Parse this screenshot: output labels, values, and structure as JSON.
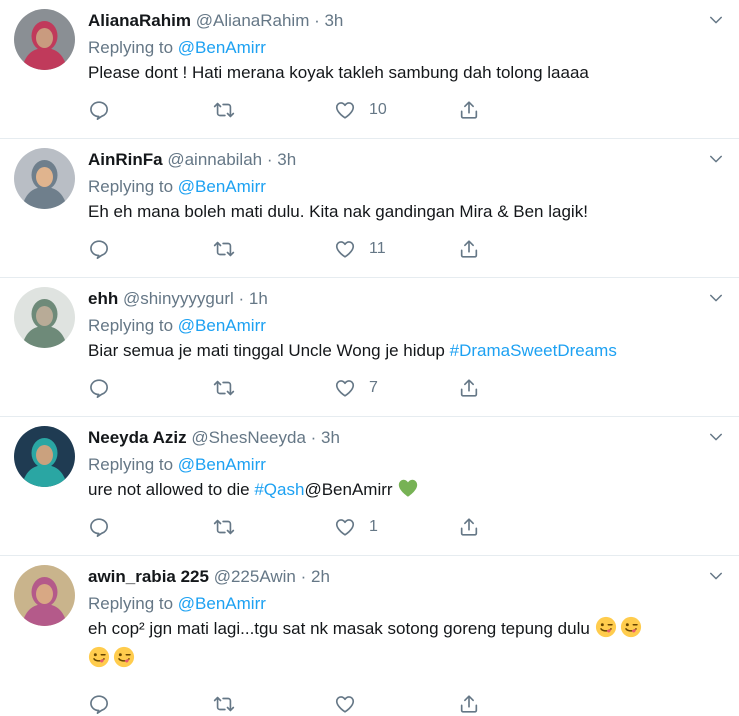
{
  "reply_prefix": "Replying to",
  "tweets": [
    {
      "name": "AlianaRahim",
      "handle": "@AlianaRahim",
      "time": "3h",
      "mention": "@BenAmirr",
      "text_before": "Please dont ! Hati merana koyak takleh sambung dah tolong laaaa",
      "likes": "10",
      "avatar_colors": {
        "bg": "#8a8f94",
        "face": "#c99b7f",
        "hijab": "#c03a5b"
      }
    },
    {
      "name": "AinRinFa",
      "handle": "@ainnabilah",
      "time": "3h",
      "mention": "@BenAmirr",
      "text_before": "Eh eh mana boleh mati dulu. Kita nak gandingan Mira & Ben lagik!",
      "likes": "11",
      "avatar_colors": {
        "bg": "#b9bec5",
        "face": "#e0b48e",
        "hijab": "#6f7f8c"
      }
    },
    {
      "name": "ehh",
      "handle": "@shinyyyygurl",
      "time": "1h",
      "mention": "@BenAmirr",
      "text_before": "Biar semua je mati tinggal Uncle Wong je hidup ",
      "hashtag": "#DramaSweetDreams",
      "likes": "7",
      "avatar_colors": {
        "bg": "#dfe3e0",
        "face": "#b8ab97",
        "hijab": "#6e8a79"
      }
    },
    {
      "name": "Neeyda Aziz",
      "handle": "@ShesNeeyda",
      "time": "3h",
      "mention": "@BenAmirr",
      "text_before": "ure not allowed to die ",
      "hashtag": "#Qash",
      "text_after": "@BenAmirr ",
      "emoji_after": "green-heart",
      "likes": "1",
      "avatar_colors": {
        "bg": "#1f3b52",
        "face": "#caa17e",
        "hijab": "#2aa6a3"
      }
    },
    {
      "name": "awin_rabia 225",
      "handle": "@225Awin",
      "time": "2h",
      "mention": "@BenAmirr",
      "text_before": "eh cop² jgn mati lagi...tgu sat nk masak sotong goreng tepung dulu ",
      "emoji_after": "winking-tongue-face",
      "likes": "",
      "avatar_colors": {
        "bg": "#c9b48c",
        "face": "#d8a884",
        "hijab": "#b45a8a"
      }
    }
  ],
  "colors": {
    "accent": "#1da1f2",
    "muted": "#657786",
    "text": "#14171a",
    "divider": "#e6ecf0",
    "heart": "#77b255",
    "emoji": "#ffcc4d"
  },
  "icons": [
    "reply-icon",
    "retweet-icon",
    "like-icon",
    "share-icon",
    "caret-down-icon"
  ]
}
